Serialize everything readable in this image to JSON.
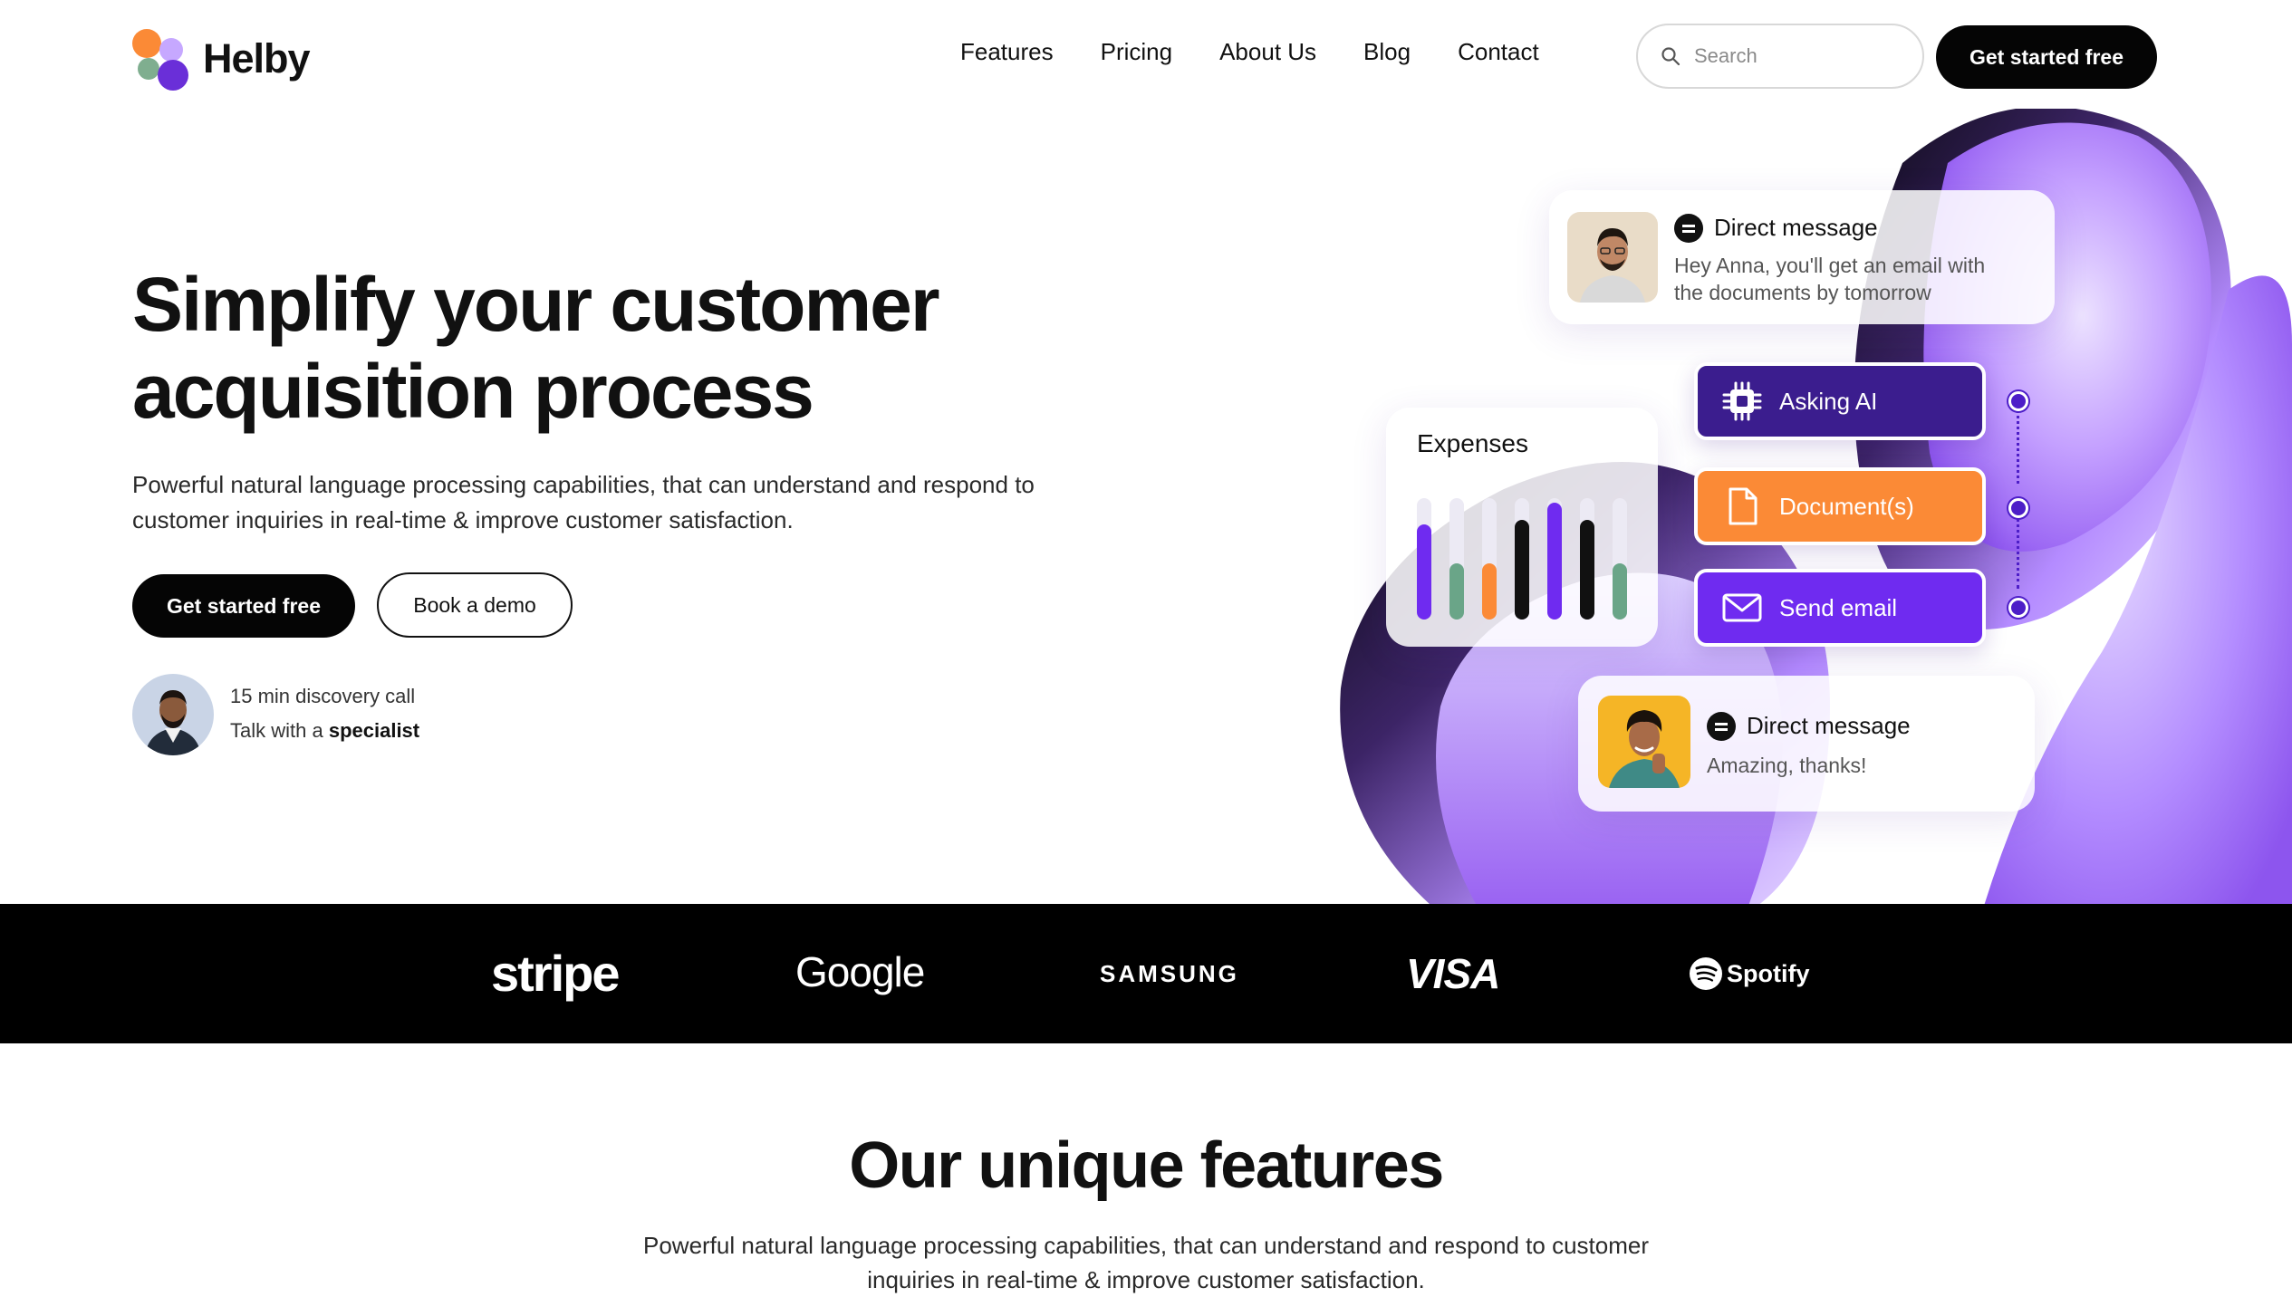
{
  "brand": {
    "name": "Helby"
  },
  "nav": {
    "links": [
      "Features",
      "Pricing",
      "About Us",
      "Blog",
      "Contact"
    ],
    "search_placeholder": "Search",
    "cta": "Get started free"
  },
  "hero": {
    "title_line1": "Simplify your customer",
    "title_line2": "acquisition process",
    "subtitle_line1": "Powerful natural language processing capabilities, that can understand and respond to",
    "subtitle_line2": "customer inquiries in real-time & improve customer satisfaction.",
    "primary_cta": "Get started free",
    "secondary_cta": "Book a demo",
    "discovery_line": "15 min discovery call",
    "talk_prefix": "Talk with a",
    "talk_bold": "specialist"
  },
  "art": {
    "dm1_title": "Direct message",
    "dm1_line1": "Hey Anna, you'll get an email with",
    "dm1_line2": "the documents by tomorrow",
    "steps": [
      "Asking AI",
      "Document(s)",
      "Send email"
    ],
    "expenses_title": "Expenses",
    "expenses_bars": [
      0.78,
      0.46,
      0.46,
      0.82,
      0.96,
      0.82,
      0.46
    ],
    "dm2_title": "Direct message",
    "dm2_text": "Amazing, thanks!"
  },
  "logos": [
    "stripe",
    "Google",
    "SAMSUNG",
    "VISA",
    "Spotify"
  ],
  "features": {
    "title": "Our unique features",
    "subtitle_line1": "Powerful natural language processing capabilities, that can understand and respond to customer",
    "subtitle_line2": "inquiries in real-time & improve customer satisfaction."
  },
  "colors": {
    "accent_purple": "#6f2bf0",
    "deep_purple": "#3b1d8e",
    "orange": "#fb8a36",
    "green": "#6aa588",
    "lavender": "#b78bff"
  }
}
